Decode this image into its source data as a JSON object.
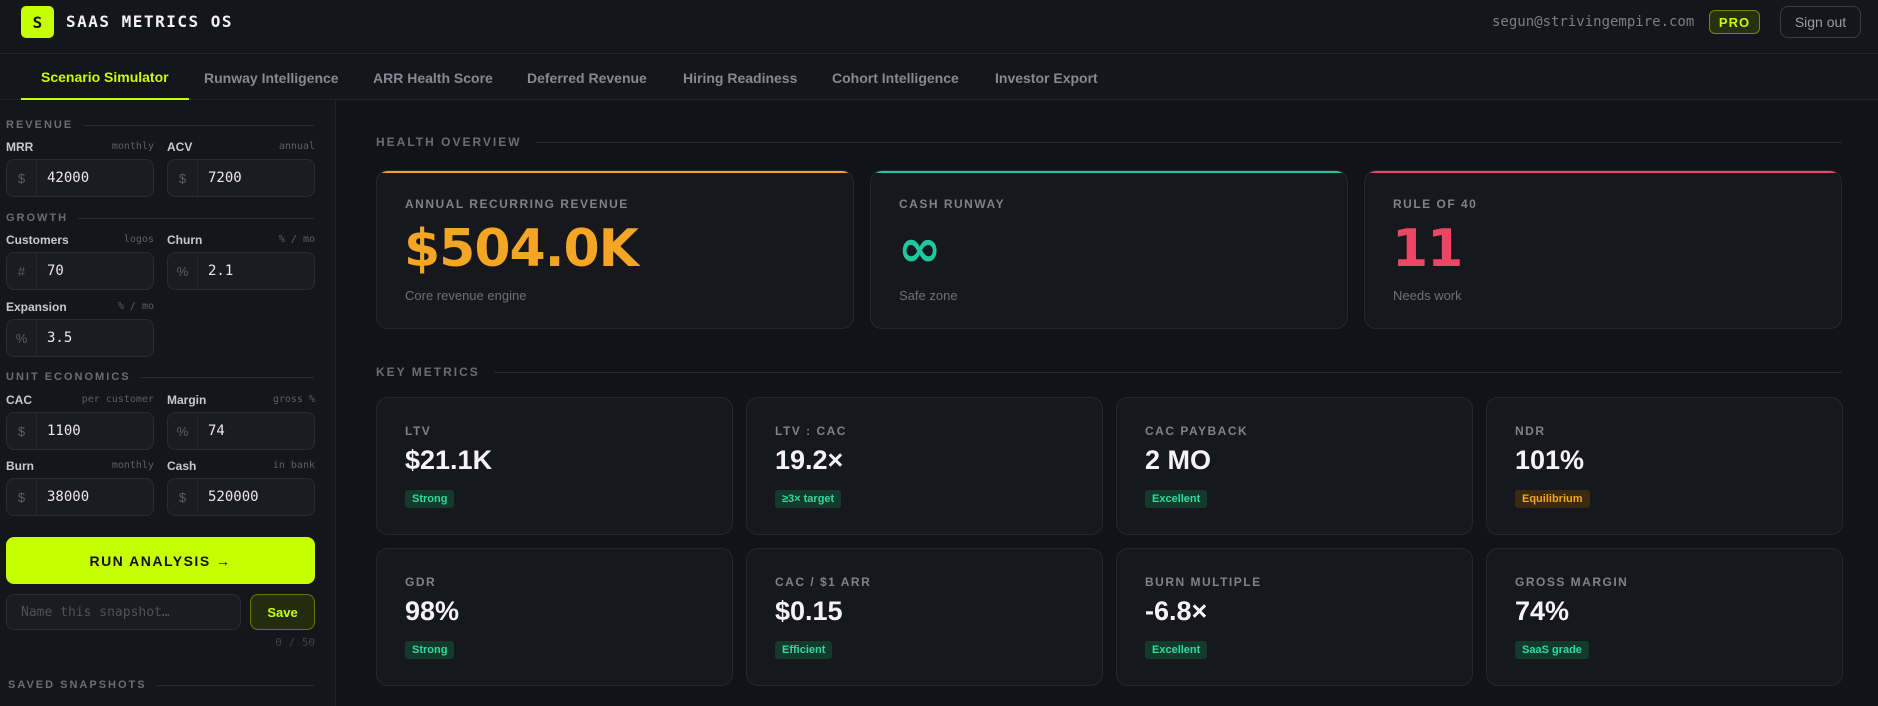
{
  "app": {
    "logo_letter": "S",
    "title": "SAAS METRICS OS",
    "user_email": "segun@strivingempire.com",
    "plan_badge": "PRO",
    "signout_label": "Sign out"
  },
  "tabs": [
    {
      "label": "Scenario Simulator",
      "active": true
    },
    {
      "label": "Runway Intelligence",
      "active": false
    },
    {
      "label": "ARR Health Score",
      "active": false
    },
    {
      "label": "Deferred Revenue",
      "active": false
    },
    {
      "label": "Hiring Readiness",
      "active": false
    },
    {
      "label": "Cohort Intelligence",
      "active": false
    },
    {
      "label": "Investor Export",
      "active": false
    }
  ],
  "sidebar": {
    "revenue": {
      "title": "REVENUE",
      "mrr": {
        "label": "MRR",
        "hint": "monthly",
        "prefix": "$",
        "value": "42000"
      },
      "acv": {
        "label": "ACV",
        "hint": "annual",
        "prefix": "$",
        "value": "7200"
      }
    },
    "growth": {
      "title": "GROWTH",
      "customers": {
        "label": "Customers",
        "hint": "logos",
        "prefix": "#",
        "value": "70"
      },
      "churn": {
        "label": "Churn",
        "hint": "% / mo",
        "prefix": "%",
        "value": "2.1"
      },
      "expansion": {
        "label": "Expansion",
        "hint": "% / mo",
        "prefix": "%",
        "value": "3.5"
      }
    },
    "unit_economics": {
      "title": "UNIT ECONOMICS",
      "cac": {
        "label": "CAC",
        "hint": "per customer",
        "prefix": "$",
        "value": "1100"
      },
      "margin": {
        "label": "Margin",
        "hint": "gross %",
        "prefix": "%",
        "value": "74"
      },
      "burn": {
        "label": "Burn",
        "hint": "monthly",
        "prefix": "$",
        "value": "38000"
      },
      "cash": {
        "label": "Cash",
        "hint": "in bank",
        "prefix": "$",
        "value": "520000"
      }
    },
    "run_label": "RUN ANALYSIS →",
    "snapshot_placeholder": "Name this snapshot…",
    "save_label": "Save",
    "counter": "0 / 50",
    "saved_title": "SAVED SNAPSHOTS"
  },
  "main": {
    "health_title": "HEALTH OVERVIEW",
    "health_cards": [
      {
        "label": "ANNUAL RECURRING REVENUE",
        "value": "$504.0K",
        "note": "Core revenue engine",
        "color": "#f5a524"
      },
      {
        "label": "CASH RUNWAY",
        "value": "∞",
        "note": "Safe zone",
        "color": "#1fc9a0"
      },
      {
        "label": "RULE OF 40",
        "value": "11",
        "note": "Needs work",
        "color": "#ef4464"
      }
    ],
    "metrics_title": "KEY METRICS",
    "metrics": [
      {
        "label": "LTV",
        "value": "$21.1K",
        "badge": "Strong",
        "tone": "green"
      },
      {
        "label": "LTV : CAC",
        "value": "19.2×",
        "badge": "≥3× target",
        "tone": "green"
      },
      {
        "label": "CAC PAYBACK",
        "value": "2 MO",
        "badge": "Excellent",
        "tone": "green"
      },
      {
        "label": "NDR",
        "value": "101%",
        "badge": "Equilibrium",
        "tone": "amber"
      },
      {
        "label": "GDR",
        "value": "98%",
        "badge": "Strong",
        "tone": "green"
      },
      {
        "label": "CAC / $1 ARR",
        "value": "$0.15",
        "badge": "Efficient",
        "tone": "green"
      },
      {
        "label": "BURN MULTIPLE",
        "value": "-6.8×",
        "badge": "Excellent",
        "tone": "green"
      },
      {
        "label": "GROSS MARGIN",
        "value": "74%",
        "badge": "SaaS grade",
        "tone": "green"
      }
    ]
  },
  "colors": {
    "accent": "#c6ff00",
    "background": "#121318",
    "card": "#17181d"
  }
}
